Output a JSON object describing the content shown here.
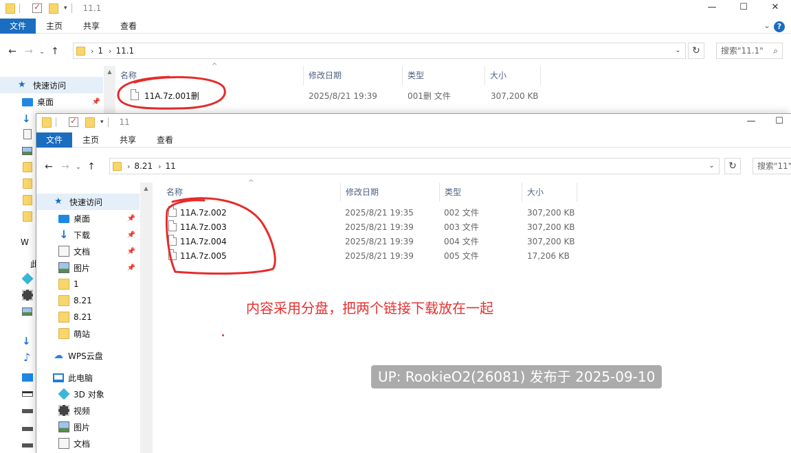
{
  "back_window": {
    "title": "11.1",
    "ribbon_tabs": [
      "文件",
      "主页",
      "共享",
      "查看"
    ],
    "breadcrumb": [
      "1",
      "11.1"
    ],
    "search_placeholder": "搜索\"11.1\"",
    "nav": {
      "quick_access": "快速访问",
      "desktop": "桌面",
      "wps": "W",
      "pc": "此"
    },
    "columns": {
      "name": "名称",
      "date": "修改日期",
      "type": "类型",
      "size": "大小"
    },
    "files": [
      {
        "name": "11A.7z.001删",
        "date": "2025/8/21 19:39",
        "type": "001删 文件",
        "size": "307,200 KB"
      }
    ]
  },
  "front_window": {
    "title": "11",
    "ribbon_tabs": [
      "文件",
      "主页",
      "共享",
      "查看"
    ],
    "breadcrumb": [
      "8.21",
      "11"
    ],
    "search_placeholder": "搜索\"11\"",
    "nav": [
      {
        "label": "快速访问",
        "icon": "star-icon",
        "pinned": false
      },
      {
        "label": "桌面",
        "icon": "desktop-icon",
        "pinned": true
      },
      {
        "label": "下载",
        "icon": "download-icon",
        "pinned": true
      },
      {
        "label": "文档",
        "icon": "document-icon",
        "pinned": true
      },
      {
        "label": "图片",
        "icon": "pictures-icon",
        "pinned": true
      },
      {
        "label": "1",
        "icon": "folder-icon",
        "pinned": false
      },
      {
        "label": "8.21",
        "icon": "folder-icon",
        "pinned": false
      },
      {
        "label": "8.21",
        "icon": "folder-icon",
        "pinned": false
      },
      {
        "label": "萌站",
        "icon": "folder-icon",
        "pinned": false
      },
      {
        "label": "WPS云盘",
        "icon": "cloud-icon",
        "pinned": false
      },
      {
        "label": "此电脑",
        "icon": "computer-icon",
        "pinned": false
      },
      {
        "label": "3D 对象",
        "icon": "3d-objects-icon",
        "pinned": false
      },
      {
        "label": "视频",
        "icon": "video-icon",
        "pinned": false
      },
      {
        "label": "图片",
        "icon": "pictures-icon",
        "pinned": false
      },
      {
        "label": "文档",
        "icon": "document-icon",
        "pinned": false
      }
    ],
    "columns": {
      "name": "名称",
      "date": "修改日期",
      "type": "类型",
      "size": "大小"
    },
    "files": [
      {
        "name": "11A.7z.002",
        "date": "2025/8/21 19:35",
        "type": "002 文件",
        "size": "307,200 KB"
      },
      {
        "name": "11A.7z.003",
        "date": "2025/8/21 19:39",
        "type": "003 文件",
        "size": "307,200 KB"
      },
      {
        "name": "11A.7z.004",
        "date": "2025/8/21 19:39",
        "type": "004 文件",
        "size": "307,200 KB"
      },
      {
        "name": "11A.7z.005",
        "date": "2025/8/21 19:39",
        "type": "005 文件",
        "size": "17,206 KB"
      }
    ]
  },
  "annotation": "内容采用分盘，把两个链接下载放在一起",
  "watermark": "UP: RookieO2(26081) 发布于 2025-09-10",
  "colors": {
    "accent": "#1a6dbf",
    "annotation": "#e83030",
    "selection": "#e5eff9"
  }
}
